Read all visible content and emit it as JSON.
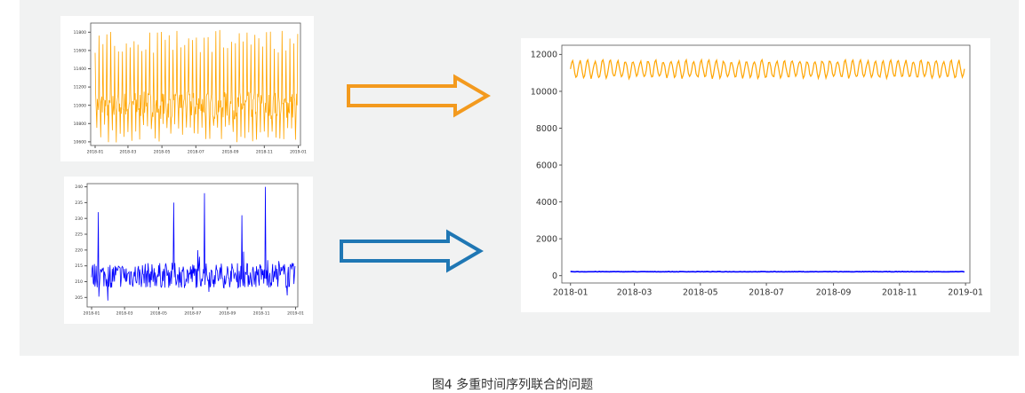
{
  "caption": "图4 多重时间序列联合的问题",
  "colors": {
    "series_orange": "#ffa500",
    "series_blue": "#0000ff",
    "arrow_orange": "#f39a1e",
    "arrow_blue": "#1f77b4",
    "panel_bg": "#f1f2f2"
  },
  "icons": {
    "arrow_top": "right-arrow-outline-icon",
    "arrow_bottom": "right-arrow-outline-icon"
  },
  "chart_data": [
    {
      "id": "top-left",
      "type": "line",
      "color": "#ffa500",
      "x_tick_labels": [
        "2018-01",
        "2018-03",
        "2018-05",
        "2018-07",
        "2018-09",
        "2018-11",
        "2019-01"
      ],
      "y_tick_values": [
        10600,
        10800,
        11000,
        11200,
        11400,
        11600,
        11800
      ],
      "ylim": [
        10560,
        11900
      ],
      "weekly_pattern": {
        "base": 11000,
        "peak": 11700,
        "trough": 10800,
        "period_days": 7,
        "start": "2018-01-01",
        "end": "2018-12-31"
      }
    },
    {
      "id": "bottom-left",
      "type": "line",
      "color": "#0000ff",
      "x_tick_labels": [
        "2018-01",
        "2018-03",
        "2018-05",
        "2018-07",
        "2018-09",
        "2018-11",
        "2019-01"
      ],
      "y_tick_values": [
        205,
        210,
        215,
        220,
        225,
        230,
        235,
        240
      ],
      "ylim": [
        202,
        241
      ],
      "baseline": {
        "mean": 212,
        "spread": 4,
        "start": "2018-01-01",
        "end": "2018-12-31"
      },
      "spikes": [
        {
          "x": "2018-01-13",
          "y": 232
        },
        {
          "x": "2018-05-28",
          "y": 235
        },
        {
          "x": "2018-07-22",
          "y": 238
        },
        {
          "x": "2018-09-27",
          "y": 231
        },
        {
          "x": "2018-11-08",
          "y": 240
        }
      ]
    },
    {
      "id": "right",
      "type": "line",
      "x_tick_labels": [
        "2018-01",
        "2018-03",
        "2018-05",
        "2018-07",
        "2018-09",
        "2018-11",
        "2019-01"
      ],
      "y_tick_values": [
        0,
        2000,
        4000,
        6000,
        8000,
        10000,
        12000
      ],
      "ylim": [
        -400,
        12500
      ],
      "series": [
        {
          "color": "#ffa500",
          "mean": 11200,
          "amplitude": 450,
          "period_days": 7,
          "start": "2018-01-01",
          "end": "2018-12-31"
        },
        {
          "color": "#0000ff",
          "mean": 212,
          "amplitude": 8,
          "start": "2018-01-01",
          "end": "2018-12-31"
        }
      ]
    }
  ]
}
